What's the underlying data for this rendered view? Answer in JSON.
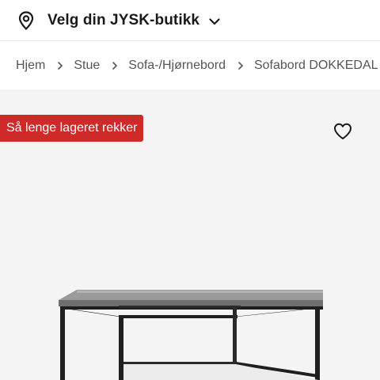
{
  "header": {
    "store_selector_label": "Velg din JYSK-butikk",
    "location_icon": "map-pin-icon",
    "dropdown_icon": "chevron-down-icon"
  },
  "breadcrumb": {
    "items": [
      "Hjem",
      "Stue",
      "Sofa-/Hjørnebord",
      "Sofabord DOKKEDAL"
    ],
    "separator_icon": "chevron-right-icon"
  },
  "product": {
    "badge": "Så lenge lageret rekker",
    "badge_color": "#cf2a2a",
    "wishlist_icon": "heart-icon",
    "image": "coffee-table-image"
  }
}
